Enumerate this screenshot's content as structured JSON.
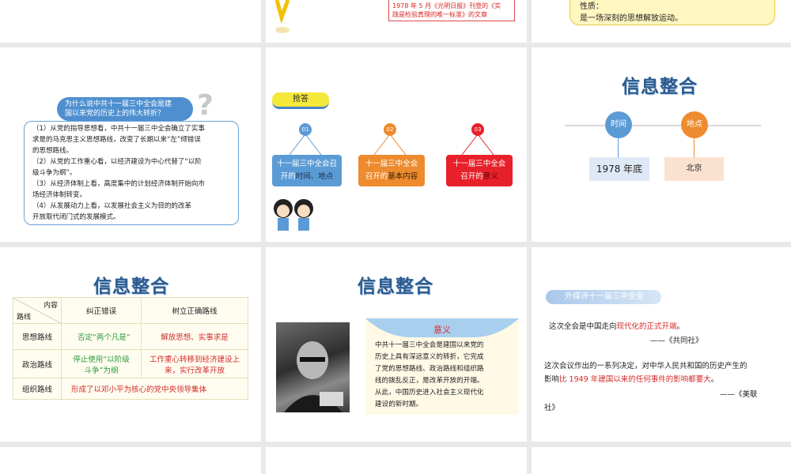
{
  "slide_top_mid": {
    "line1": "1978 年 5 月《光明日报》刊登的《实",
    "line2": "践是检验真理的唯一标准》的文章"
  },
  "slide_top_right": {
    "line1": "性质：",
    "line2": "是一场深刻的思想解放运动。"
  },
  "slide_question": {
    "bubble_line1": "为什么说中共十一届三中全会是建",
    "bubble_line2": "国以来党的历史上的伟大转折？",
    "lines": [
      "（1）从党的指导思想看，中共十一届三中全会确立了实事",
      "求是的马克思主义思想路线，改变了长期以来“左”倾错误",
      "的思想路线。",
      "（2）从党的工作重心看，以经济建设为中心代替了“以阶",
      "级斗争为纲”。",
      "（3）从经济体制上看，高度集中的计划经济体制开始向市",
      "场经济体制转变。",
      "（4）从发展动力上看，以发展社会主义为目的的改革",
      "开放取代闭门式的发展模式。"
    ]
  },
  "slide_quiz": {
    "tag": "抢答",
    "items": [
      {
        "num": "01",
        "line1": "十一届三中全会召",
        "line2a": "开的",
        "line2b": "时间、地点",
        "color": "#5b9bd5",
        "dot": "#5b9bd5"
      },
      {
        "num": "02",
        "line1": "十一届三中全会",
        "line2a": "召开的",
        "line2b": "基本内容",
        "color": "#ed8b2e",
        "dot": "#ed8b2e"
      },
      {
        "num": "03",
        "line1": "十一届三中全会",
        "line2a": "召开的",
        "line2b": "意义",
        "color": "#e8202a",
        "dot": "#e8202a"
      }
    ]
  },
  "slide_info1": {
    "title": "信息整合",
    "time_label": "时间",
    "place_label": "地点",
    "time_value": "1978 年底",
    "place_value": "北京"
  },
  "slide_table": {
    "title": "信息整合",
    "corner_top": "内容",
    "corner_bottom": "路线",
    "col1": "纠正错误",
    "col2": "树立正确路线",
    "rows": [
      {
        "head": "思想路线",
        "a": "否定“两个凡是”",
        "b": "解放思想、实事求是"
      },
      {
        "head": "政治路线",
        "a": "停止使用“以阶级斗争”为纲",
        "b": "工作重心转移到经济建设上来，实行改革开放"
      },
      {
        "head": "组织路线",
        "merged": "形成了以邓小平为核心的党中央领导集体"
      }
    ]
  },
  "slide_meaning": {
    "title": "信息整合",
    "heading": "意义",
    "lines": [
      "中共十一届三中全会是建国以来党的",
      "历史上具有深远意义的转折，它完成",
      "了党的思想路线、政治路线和组织路",
      "线的拨乱反正，是改革开放的开端。",
      "从此，中国历史进入社会主义现代化",
      "建设的新时期。"
    ]
  },
  "slide_media": {
    "ribbon": "外媒评十一届三中全会",
    "q1_pre": "这次全会是中国走向",
    "q1_red": "现代化的正式开端",
    "q1_post": "。",
    "q1_src": "——《共同社》",
    "q2_line1": "这次会议作出的一系列决定，对中华人民共和国的历史产生的",
    "q2_pre": "影响",
    "q2_red": "比 1949 年建国以来的任何事件的影响都要大",
    "q2_post": "。",
    "q2_src": "——《美联",
    "q2_src2": "社》"
  }
}
